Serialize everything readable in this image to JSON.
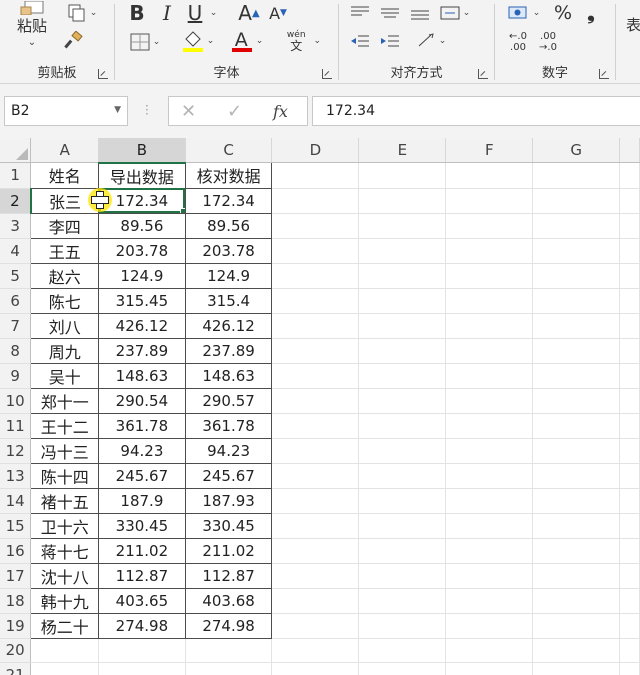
{
  "ribbon": {
    "clipboard": {
      "paste_label": "粘贴",
      "group_label": "剪贴板"
    },
    "font": {
      "group_label": "字体",
      "bold": "B",
      "italic": "I",
      "underline": "U",
      "grow": "A",
      "shrink": "A",
      "font_color": "A",
      "phonetic_top": "wén",
      "phonetic_bottom": "文"
    },
    "alignment": {
      "group_label": "对齐方式"
    },
    "number": {
      "group_label": "数字",
      "percent": "%",
      "comma": "❟",
      "inc_decimal_top": "←.0",
      "inc_decimal_bottom": ".00",
      "dec_decimal_top": ".00",
      "dec_decimal_bottom": "→.0"
    },
    "next_group_partial": "表"
  },
  "formula_bar": {
    "name_box": "B2",
    "cancel": "✕",
    "enter": "✓",
    "fx": "fx",
    "value": "172.34"
  },
  "colors": {
    "accent": "#217346",
    "header_bg": "#f2f2f2",
    "selected_header_bg": "#d6d6d6"
  },
  "grid": {
    "columns": [
      "A",
      "B",
      "C",
      "D",
      "E",
      "F",
      "G"
    ],
    "rows": [
      "1",
      "2",
      "3",
      "4",
      "5",
      "6",
      "7",
      "8",
      "9",
      "10",
      "11",
      "12",
      "13",
      "14",
      "15",
      "16",
      "17",
      "18",
      "19",
      "20",
      "21"
    ],
    "header": {
      "name": "姓名",
      "exported": "导出数据",
      "checked": "核对数据"
    },
    "records": [
      {
        "name": "张三",
        "exported": "172.34",
        "checked": "172.34"
      },
      {
        "name": "李四",
        "exported": "89.56",
        "checked": "89.56"
      },
      {
        "name": "王五",
        "exported": "203.78",
        "checked": "203.78"
      },
      {
        "name": "赵六",
        "exported": "124.9",
        "checked": "124.9"
      },
      {
        "name": "陈七",
        "exported": "315.45",
        "checked": "315.4"
      },
      {
        "name": "刘八",
        "exported": "426.12",
        "checked": "426.12"
      },
      {
        "name": "周九",
        "exported": "237.89",
        "checked": "237.89"
      },
      {
        "name": "吴十",
        "exported": "148.63",
        "checked": "148.63"
      },
      {
        "name": "郑十一",
        "exported": "290.54",
        "checked": "290.57"
      },
      {
        "name": "王十二",
        "exported": "361.78",
        "checked": "361.78"
      },
      {
        "name": "冯十三",
        "exported": "94.23",
        "checked": "94.23"
      },
      {
        "name": "陈十四",
        "exported": "245.67",
        "checked": "245.67"
      },
      {
        "name": "褚十五",
        "exported": "187.9",
        "checked": "187.93"
      },
      {
        "name": "卫十六",
        "exported": "330.45",
        "checked": "330.45"
      },
      {
        "name": "蒋十七",
        "exported": "211.02",
        "checked": "211.02"
      },
      {
        "name": "沈十八",
        "exported": "112.87",
        "checked": "112.87"
      },
      {
        "name": "韩十九",
        "exported": "403.65",
        "checked": "403.68"
      },
      {
        "name": "杨二十",
        "exported": "274.98",
        "checked": "274.98"
      }
    ]
  }
}
